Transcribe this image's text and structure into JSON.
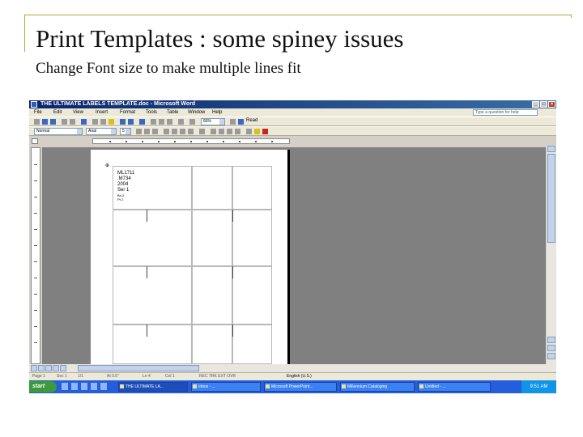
{
  "slide": {
    "title": "Print Templates : some spiney issues",
    "subtitle": "Change Font size to make multiple lines fit",
    "accent_color": "#b8a23a"
  },
  "word": {
    "window_title": "THE ULTIMATE LABELS TEMPLATE.doc - Microsoft Word",
    "window_buttons": [
      "minimize-icon",
      "maximize-icon",
      "close-icon"
    ],
    "menu": [
      "File",
      "Edit",
      "View",
      "Insert",
      "Format",
      "Tools",
      "Table",
      "Window",
      "Help"
    ],
    "help_box_placeholder": "Type a question for help",
    "style_box": "Normal",
    "font_box": "Arial",
    "size_box": "5",
    "zoom_box": "66%",
    "read_label": "Read",
    "label_cell": {
      "line1": "ML1711",
      "line2": ".M734",
      "line3": "2004",
      "line4": "Ser 1",
      "line5": "Bd.2",
      "line6": "Pt 2"
    },
    "status": {
      "page": "Page 1",
      "sec": "Sec 1",
      "pages": "1/1",
      "at": "At 0.5\"",
      "ln": "Ln 4",
      "col": "Col 1",
      "flags": "REC TRK EXT OVR",
      "lang": "English (U.S.)"
    },
    "taskbar": {
      "start": "start",
      "tasks": [
        "THE ULTIMATE LA...",
        "Inbox - ...",
        "Microsoft PowerPoint...",
        "Millennium Cataloging",
        "Untitled - ..."
      ],
      "clock": "9:51 AM"
    }
  }
}
